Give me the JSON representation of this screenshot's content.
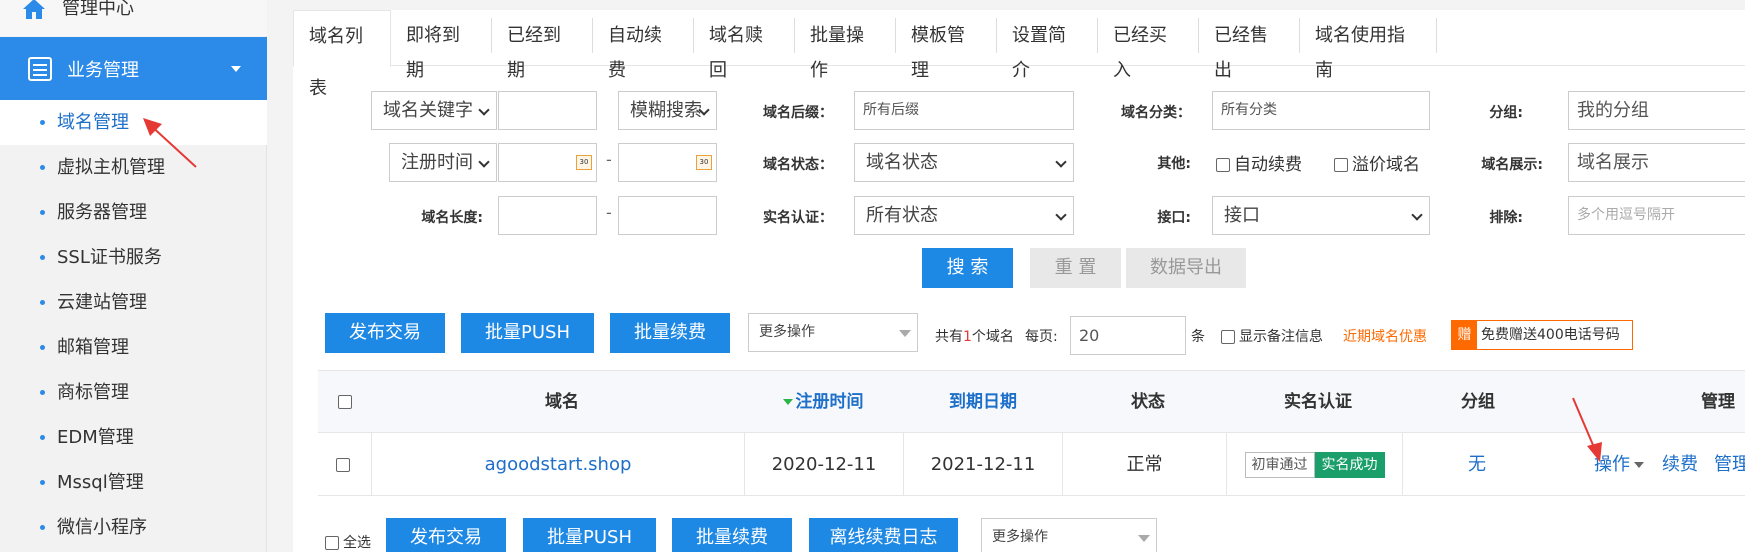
{
  "sidebar": {
    "top_label": "管理中心",
    "active_label": "业务管理",
    "items": [
      {
        "label": "域名管理"
      },
      {
        "label": "虚拟主机管理"
      },
      {
        "label": "服务器管理"
      },
      {
        "label": "SSL证书服务"
      },
      {
        "label": "云建站管理"
      },
      {
        "label": "邮箱管理"
      },
      {
        "label": "商标管理"
      },
      {
        "label": "EDM管理"
      },
      {
        "label": "Mssql管理"
      },
      {
        "label": "微信小程序"
      }
    ]
  },
  "tabs": [
    "域名列表",
    "即将到期",
    "已经到期",
    "自动续费",
    "域名赎回",
    "批量操作",
    "模板管理",
    "设置简介",
    "已经买入",
    "已经售出",
    "域名使用指南"
  ],
  "filters": {
    "keyword_select": "域名关键字",
    "fuzzy_select": "模糊搜索",
    "suffix_label": "域名后缀：",
    "suffix_value": "所有后缀",
    "category_label": "域名分类：",
    "category_value": "所有分类",
    "group_label": "分组:",
    "group_value": "我的分组",
    "regtime_select": "注册时间",
    "cal_text": "30",
    "dash": "-",
    "status_label": "域名状态：",
    "status_value": "域名状态",
    "other_label": "其他:",
    "auto_renew": "自动续费",
    "premium": "溢价域名",
    "display_label": "域名展示:",
    "display_value": "域名展示",
    "length_label": "域名长度:",
    "realname_label": "实名认证：",
    "realname_value": "所有状态",
    "api_label": "接口:",
    "api_value": "接口",
    "exclude_label": "排除:",
    "exclude_placeholder": "多个用逗号隔开",
    "search_btn": "搜 索",
    "reset_btn": "重 置",
    "export_btn": "数据导出"
  },
  "toolbar": {
    "publish": "发布交易",
    "batch_push": "批量PUSH",
    "batch_renew": "批量续费",
    "more_ops": "更多操作",
    "total_prefix": "共有",
    "total_count": "1",
    "total_suffix": "个域名",
    "per_page_label": "每页:",
    "per_page_value": "20",
    "per_page_unit": "条",
    "show_notes": "显示备注信息",
    "expire_promo": "近期域名优惠",
    "gift_tag": "赠",
    "gift_text": "免费赠送400电话号码"
  },
  "table": {
    "headers": {
      "domain": "域名",
      "reg_time": "注册时间",
      "expire": "到期日期",
      "status": "状态",
      "realname": "实名认证",
      "group": "分组",
      "manage": "管理"
    },
    "rows": [
      {
        "domain": "agoodstart.shop",
        "reg_time": "2020-12-11",
        "expire": "2021-12-11",
        "status": "正常",
        "realname_a": "初审通过",
        "realname_b": "实名成功",
        "group": "无",
        "op_action": "操作",
        "op_renew": "续费",
        "op_manage": "管理"
      }
    ]
  },
  "bottom": {
    "select_all": "全选",
    "publish": "发布交易",
    "batch_push": "批量PUSH",
    "batch_renew": "批量续费",
    "offline_log": "离线续费日志",
    "more_ops": "更多操作"
  },
  "colors": {
    "accent": "#2c8ae8",
    "button": "#1e88e5",
    "success": "#1a9e6a",
    "orange": "#ff6a00",
    "arrow": "#e53935"
  }
}
